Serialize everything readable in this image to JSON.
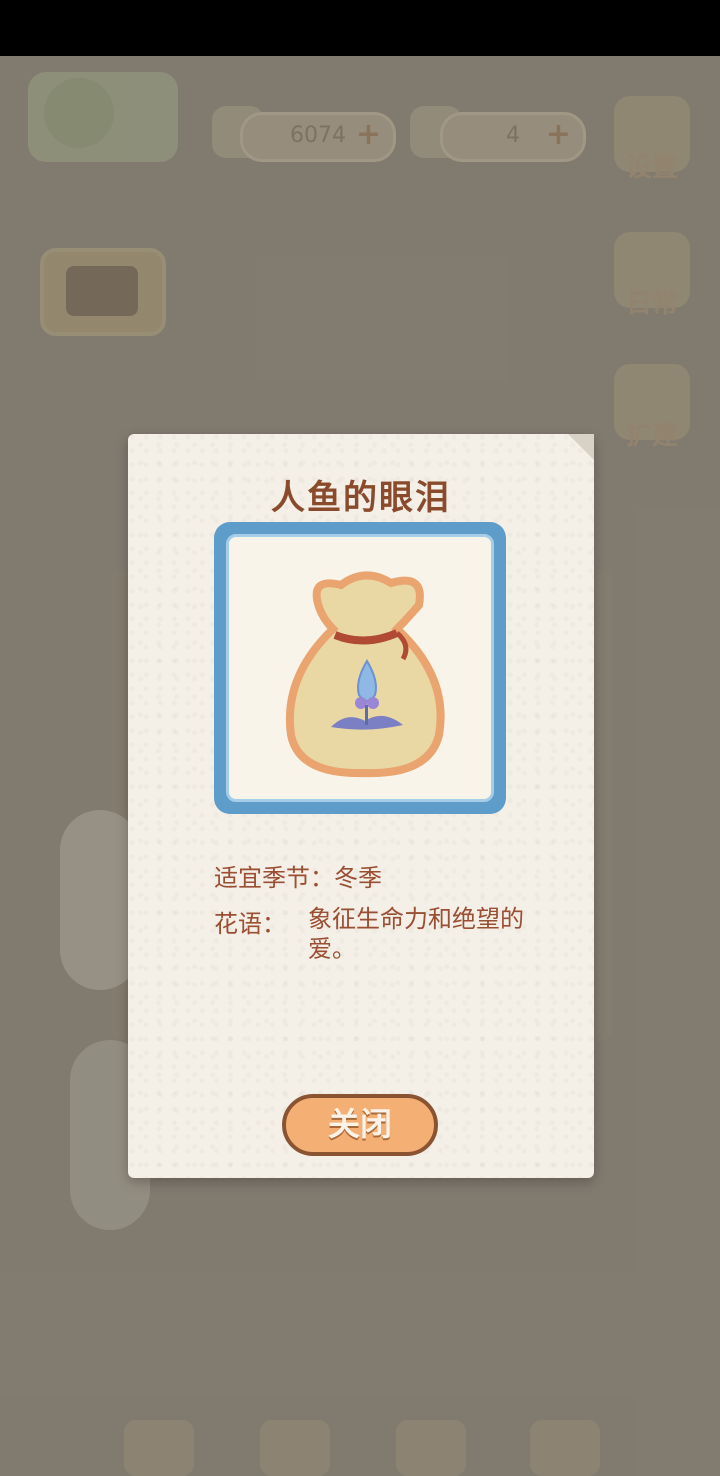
{
  "hud": {
    "fish_count": "6074",
    "cheese_count": "4",
    "settings_label": "设置",
    "daily_label": "日常",
    "expand_label": "扩建"
  },
  "dialog": {
    "title": "人鱼的眼泪",
    "season_label": "适宜季节：",
    "season_value": "冬季",
    "flower_lang_label": "花语：",
    "flower_lang_value": "象征生命力和绝望的爱。",
    "close_label": "关闭"
  },
  "icons": {
    "fish": "fish-bone-icon",
    "cheese": "cheese-icon",
    "plus": "plus-icon",
    "settings": "gear-icon",
    "daily": "scroll-icon",
    "expand": "build-icon",
    "bag": "briefcase-icon",
    "item": "seed-bag-icon"
  },
  "colors": {
    "title": "#8a4b2c",
    "frame": "#5e9cc9",
    "button": "#f4b074"
  }
}
